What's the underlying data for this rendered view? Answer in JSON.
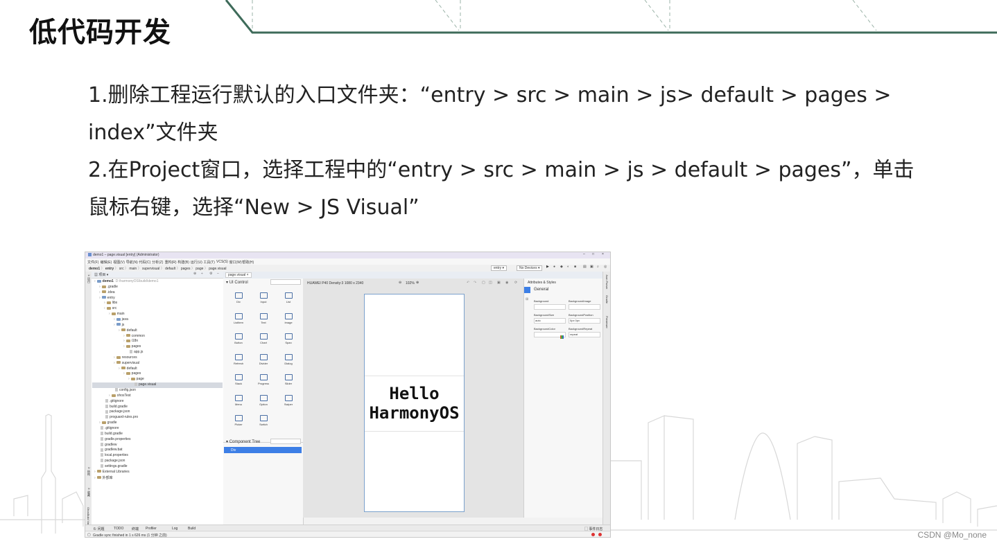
{
  "slide": {
    "title": "低代码开发",
    "lines": [
      "1.删除工程运行默认的入口文件夹：“entry > src > main > js> default > pages >",
      "index”文件夹",
      "2.在Project窗口，选择工程中的“entry > src > main > js > default > pages”，单击",
      "鼠标右键，选择“New > JS Visual”"
    ],
    "watermark": "CSDN @Mo_none"
  },
  "ide": {
    "window_title": "demo1 – page.visual [entry] (Administrator)",
    "menu": [
      "文件(F)",
      "编辑(E)",
      "视图(V)",
      "导航(N)",
      "代码(C)",
      "分析(Z)",
      "重构(R)",
      "构建(B)",
      "运行(U)",
      "工具(T)",
      "VCS(S)",
      "窗口(W)",
      "帮助(H)"
    ],
    "breadcrumb": [
      "demo1",
      "entry",
      "src",
      "main",
      "supervisual",
      "default",
      "pages",
      "page",
      "page.visual"
    ],
    "run_config": "entry",
    "device": "No Devices",
    "project_view_label": "项目",
    "editor_tab": "page.visual",
    "project_tree": [
      {
        "label": "demo1",
        "note": "D:\\harmonyOS\\build\\demo1",
        "depth": 0,
        "kind": "folder-blue"
      },
      {
        "label": ".gradle",
        "depth": 1,
        "kind": "folder"
      },
      {
        "label": ".idea",
        "depth": 1,
        "kind": "folder"
      },
      {
        "label": "entry",
        "depth": 1,
        "kind": "folder-blue"
      },
      {
        "label": "libs",
        "depth": 2,
        "kind": "folder"
      },
      {
        "label": "src",
        "depth": 2,
        "kind": "folder"
      },
      {
        "label": "main",
        "depth": 3,
        "kind": "folder"
      },
      {
        "label": "java",
        "depth": 4,
        "kind": "folder-blue"
      },
      {
        "label": "js",
        "depth": 4,
        "kind": "folder-blue"
      },
      {
        "label": "default",
        "depth": 5,
        "kind": "folder"
      },
      {
        "label": "common",
        "depth": 6,
        "kind": "folder"
      },
      {
        "label": "i18n",
        "depth": 6,
        "kind": "folder"
      },
      {
        "label": "pages",
        "depth": 6,
        "kind": "folder"
      },
      {
        "label": "app.js",
        "depth": 7,
        "kind": "file"
      },
      {
        "label": "resources",
        "depth": 4,
        "kind": "folder"
      },
      {
        "label": "supervisual",
        "depth": 4,
        "kind": "folder"
      },
      {
        "label": "default",
        "depth": 5,
        "kind": "folder"
      },
      {
        "label": "pages",
        "depth": 6,
        "kind": "folder"
      },
      {
        "label": "page",
        "depth": 7,
        "kind": "folder"
      },
      {
        "label": "page.visual",
        "depth": 8,
        "kind": "file"
      },
      {
        "label": "config.json",
        "depth": 4,
        "kind": "file"
      },
      {
        "label": "ohosTest",
        "depth": 3,
        "kind": "folder"
      },
      {
        "label": ".gitignore",
        "depth": 2,
        "kind": "file"
      },
      {
        "label": "build.gradle",
        "depth": 2,
        "kind": "file"
      },
      {
        "label": "package.json",
        "depth": 2,
        "kind": "file"
      },
      {
        "label": "proguard-rules.pro",
        "depth": 2,
        "kind": "file"
      },
      {
        "label": "gradle",
        "depth": 1,
        "kind": "folder"
      },
      {
        "label": ".gitignore",
        "depth": 1,
        "kind": "file"
      },
      {
        "label": "build.gradle",
        "depth": 1,
        "kind": "file"
      },
      {
        "label": "gradle.properties",
        "depth": 1,
        "kind": "file"
      },
      {
        "label": "gradlew",
        "depth": 1,
        "kind": "file"
      },
      {
        "label": "gradlew.bat",
        "depth": 1,
        "kind": "file"
      },
      {
        "label": "local.properties",
        "depth": 1,
        "kind": "file"
      },
      {
        "label": "package.json",
        "depth": 1,
        "kind": "file"
      },
      {
        "label": "settings.gradle",
        "depth": 1,
        "kind": "file"
      },
      {
        "label": "External Libraries",
        "depth": 0,
        "kind": "folder"
      },
      {
        "label": "外部库",
        "depth": 0,
        "kind": "folder"
      }
    ],
    "palette_title": "UI Control",
    "palette": [
      {
        "label": "Div",
        "icon": "div-icon"
      },
      {
        "label": "Input",
        "icon": "input-icon"
      },
      {
        "label": "List",
        "icon": "list-icon"
      },
      {
        "label": "ListItem",
        "icon": "listitem-icon"
      },
      {
        "label": "Text",
        "icon": "text-icon"
      },
      {
        "label": "Image",
        "icon": "image-icon"
      },
      {
        "label": "Button",
        "icon": "button-icon"
      },
      {
        "label": "Chart",
        "icon": "chart-icon"
      },
      {
        "label": "Span",
        "icon": "span-icon"
      },
      {
        "label": "Refresh",
        "icon": "refresh-icon"
      },
      {
        "label": "Divider",
        "icon": "divider-icon"
      },
      {
        "label": "Dialog",
        "icon": "dialog-icon"
      },
      {
        "label": "Stack",
        "icon": "stack-icon"
      },
      {
        "label": "Progress",
        "icon": "progress-icon"
      },
      {
        "label": "Slider",
        "icon": "slider-icon"
      },
      {
        "label": "Menu",
        "icon": "menu-icon"
      },
      {
        "label": "Option",
        "icon": "option-icon"
      },
      {
        "label": "Swiper",
        "icon": "swiper-icon"
      },
      {
        "label": "Picker",
        "icon": "picker-icon"
      },
      {
        "label": "Switch",
        "icon": "switch-icon"
      }
    ],
    "component_tree_title": "Component Tree",
    "component_tree_item": "Div",
    "device_info": "HUAWEI P40   Density:3   1080 x 2340",
    "zoom": "102%",
    "phone_text_line1": "Hello",
    "phone_text_line2": "HarmonyOS",
    "attrs_title": "Attributes & Styles",
    "attrs_section": "General",
    "attrs": [
      {
        "label": "Background",
        "value": ""
      },
      {
        "label": "BackgroundImage",
        "value": ""
      },
      {
        "label": "BackgroundSize",
        "value": "auto"
      },
      {
        "label": "BackgroundPosition",
        "value": "0px 0px"
      },
      {
        "label": "BackgroundColor",
        "value": ""
      },
      {
        "label": "BackgroundRepeat",
        "value": "repeat"
      }
    ],
    "right_strip_labels": [
      "Json Parser",
      "Gradle",
      "Previewer"
    ],
    "bottom_tabs": [
      "6: 问题",
      "TODO",
      "终端",
      "Profiler",
      "Log",
      "Build"
    ],
    "event_log": "事件日志",
    "status": "Gradle sync finished in 1 s 626 ms (1 分钟 之前)",
    "colors": {
      "accent": "#3d7fe6",
      "slide_line": "#3e6b5a"
    }
  }
}
